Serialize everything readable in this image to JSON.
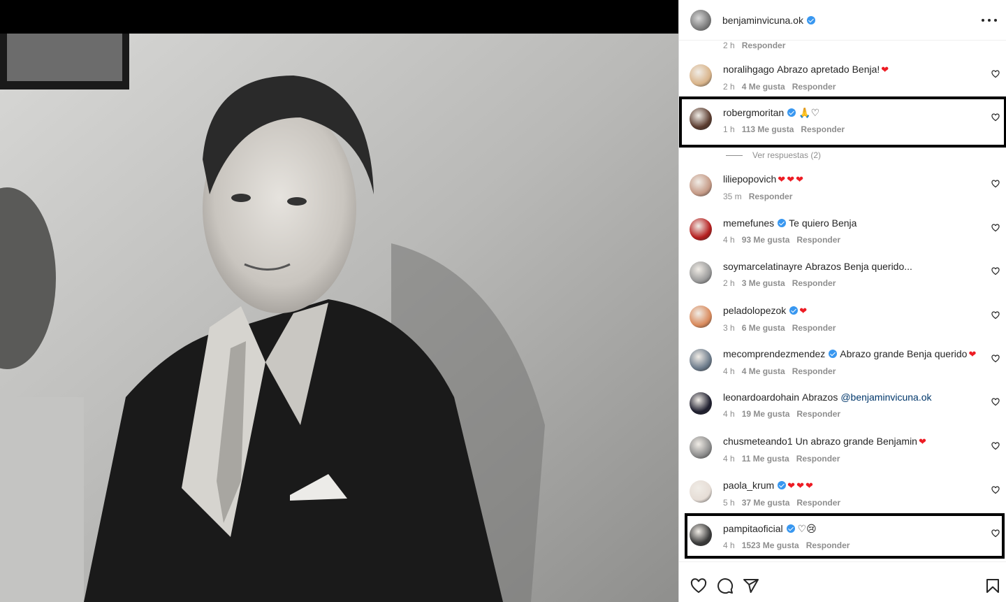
{
  "post": {
    "author": "benjaminvicuna.ok",
    "photo_alt": "Fotografía en blanco y negro de un hombre de traje oscuro con pañuelo en el bolsillo"
  },
  "top_meta": {
    "time": "2 h",
    "reply": "Responder"
  },
  "comments": [
    {
      "user": "noralihgago",
      "verified": false,
      "text": "Abrazo apretado Benja!",
      "emoji": "heart",
      "time": "2 h",
      "likes": "4 Me gusta",
      "reply": "Responder",
      "avatar_color": "#d9b48a"
    },
    {
      "user": "robergmoritan",
      "verified": true,
      "text": "🙏♡",
      "emoji": "",
      "time": "1 h",
      "likes": "113 Me gusta",
      "reply": "Responder",
      "avatar_color": "#5a3b2e"
    },
    {
      "user": "liliepopovich",
      "verified": false,
      "text": "",
      "emoji": "hearts3",
      "time": "35 m",
      "likes": "",
      "reply": "Responder",
      "avatar_color": "#c59a86"
    },
    {
      "user": "memefunes",
      "verified": true,
      "text": "Te quiero Benja",
      "emoji": "",
      "time": "4 h",
      "likes": "93 Me gusta",
      "reply": "Responder",
      "avatar_color": "#b51d1d"
    },
    {
      "user": "soymarcelatinayre",
      "verified": false,
      "text": "Abrazos Benja querido...",
      "emoji": "",
      "time": "2 h",
      "likes": "3 Me gusta",
      "reply": "Responder",
      "avatar_color": "#9a9a9a"
    },
    {
      "user": "peladolopezok",
      "verified": true,
      "text": "",
      "emoji": "heart",
      "time": "3 h",
      "likes": "6 Me gusta",
      "reply": "Responder",
      "avatar_color": "#d98a5c"
    },
    {
      "user": "mecomprendezmendez",
      "verified": true,
      "text": "Abrazo grande Benja querido",
      "emoji": "heart",
      "time": "4 h",
      "likes": "4 Me gusta",
      "reply": "Responder",
      "avatar_color": "#6b7a8a"
    },
    {
      "user": "leonardoardohain",
      "verified": false,
      "text": "Abrazos",
      "mention": "@benjaminvicuna.ok",
      "emoji": "",
      "time": "4 h",
      "likes": "19 Me gusta",
      "reply": "Responder",
      "avatar_color": "#1e1e2e"
    },
    {
      "user": "chusmeteando1",
      "verified": false,
      "text": "Un abrazo grande Benjamin",
      "emoji": "heart",
      "time": "4 h",
      "likes": "11 Me gusta",
      "reply": "Responder",
      "avatar_color": "#8c8c8c"
    },
    {
      "user": "paola_krum",
      "verified": true,
      "text": "",
      "emoji": "hearts3",
      "time": "5 h",
      "likes": "37 Me gusta",
      "reply": "Responder",
      "avatar_color": "#e6ddd6"
    },
    {
      "user": "pampitaoficial",
      "verified": true,
      "text": "♡😢",
      "emoji": "",
      "time": "4 h",
      "likes": "1523 Me gusta",
      "reply": "Responder",
      "avatar_color": "#3a3a3a"
    }
  ],
  "view_replies": "Ver respuestas (2)",
  "colors": {
    "verified": "#3897f0",
    "heart": "#ed1c24",
    "highlight": "#000000"
  },
  "icons": [
    "more-icon",
    "heart-icon",
    "comment-icon",
    "share-icon",
    "bookmark-icon"
  ]
}
